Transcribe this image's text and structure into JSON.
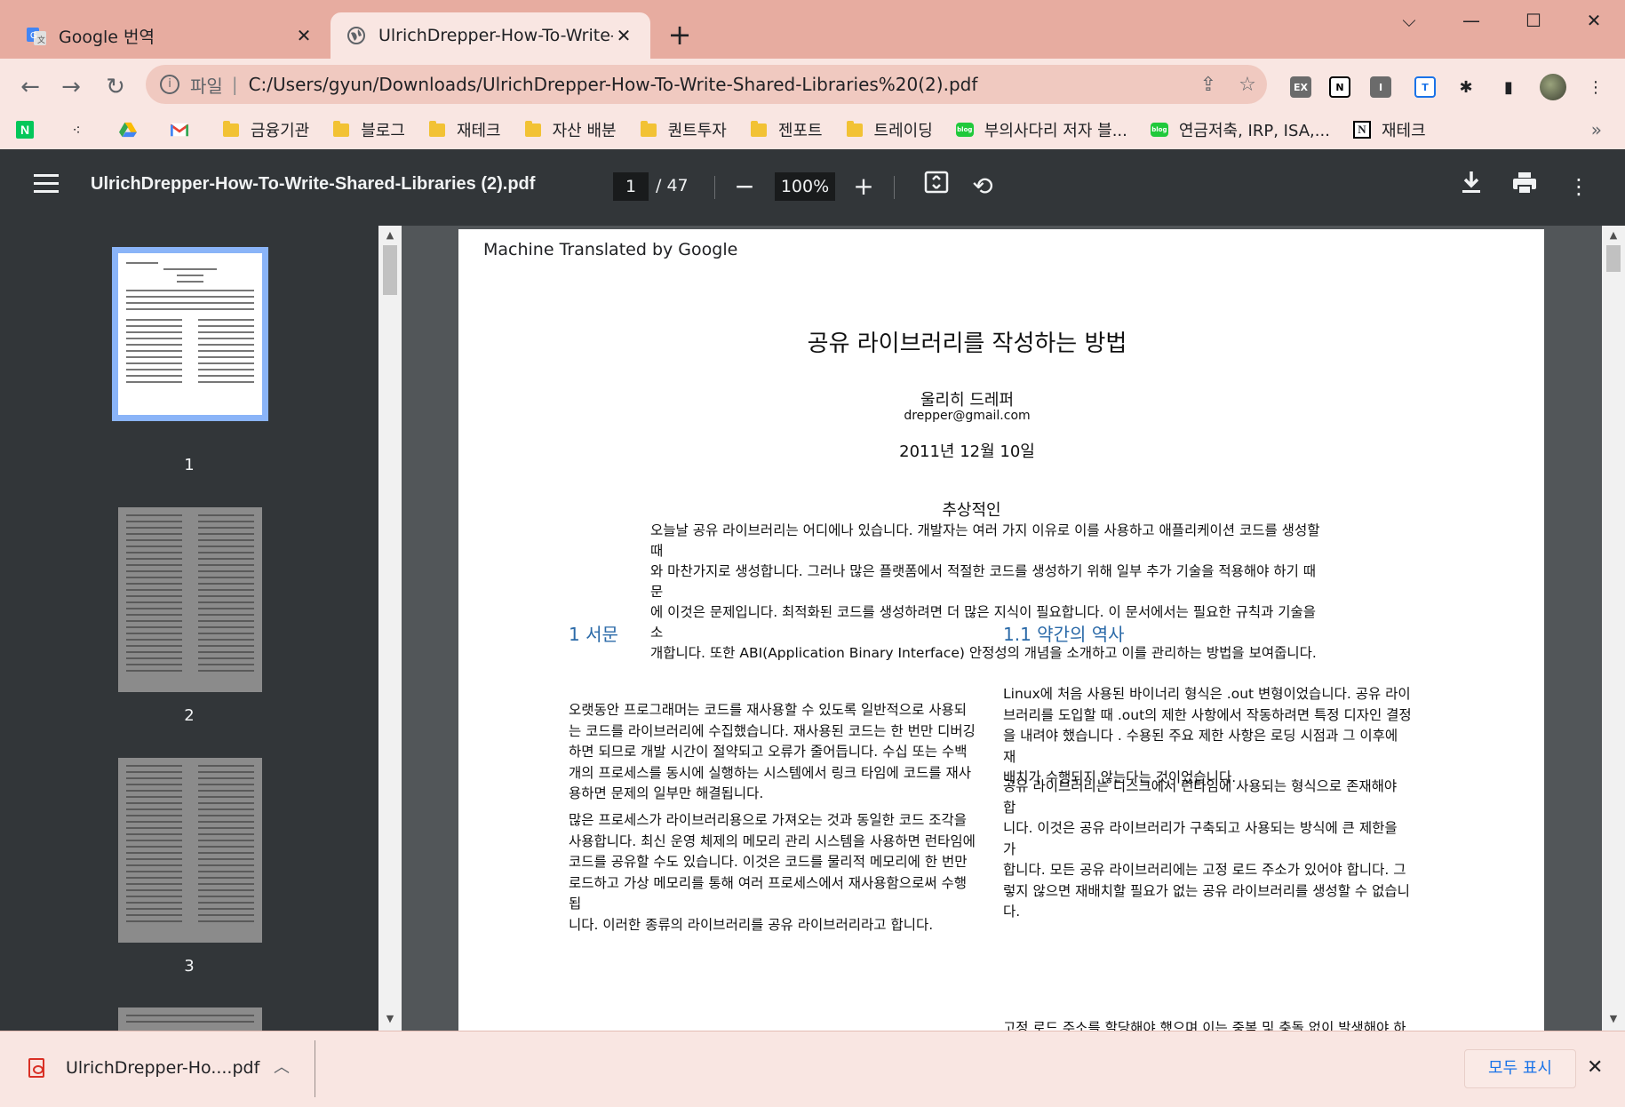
{
  "tabs": [
    {
      "title": "Google 번역",
      "favicon": "google-translate-icon",
      "active": false
    },
    {
      "title": "UlrichDrepper-How-To-Write-Sh",
      "favicon": "globe-icon",
      "active": true
    }
  ],
  "window": {
    "accent": "#e7aca0",
    "toolbar_bg": "#f9e6e2"
  },
  "omnibox": {
    "scheme": "파일",
    "separator": "|",
    "url": "C:/Users/gyun/Downloads/UlrichDrepper-How-To-Write-Shared-Libraries%20(2).pdf"
  },
  "extensions": [
    {
      "name": "ex-extension-icon",
      "label": "EX"
    },
    {
      "name": "notion-extension-icon",
      "label": "N"
    },
    {
      "name": "i-extension-icon",
      "label": "I"
    },
    {
      "name": "translate-extension-icon",
      "label": "T"
    },
    {
      "name": "puzzle-extension-icon",
      "label": "✱"
    },
    {
      "name": "sidepanel-icon",
      "label": "▮"
    },
    {
      "name": "profile-avatar-icon",
      "label": ""
    },
    {
      "name": "chrome-menu-icon",
      "label": "⋮"
    }
  ],
  "bookmarks": [
    {
      "label": "",
      "icon": "naver-icon"
    },
    {
      "label": "",
      "icon": "dots-app-icon"
    },
    {
      "label": "",
      "icon": "google-drive-icon"
    },
    {
      "label": "",
      "icon": "gmail-icon"
    },
    {
      "label": "금융기관",
      "icon": "folder-icon"
    },
    {
      "label": "블로그",
      "icon": "folder-icon"
    },
    {
      "label": "재테크",
      "icon": "folder-icon"
    },
    {
      "label": "자산 배분",
      "icon": "folder-icon"
    },
    {
      "label": "퀀트투자",
      "icon": "folder-icon"
    },
    {
      "label": "젠포트",
      "icon": "folder-icon"
    },
    {
      "label": "트레이딩",
      "icon": "folder-icon"
    },
    {
      "label": "부의사다리 저자 블...",
      "icon": "blog-icon"
    },
    {
      "label": "연금저축, IRP, ISA,...",
      "icon": "blog-icon"
    },
    {
      "label": "재테크",
      "icon": "notion-icon"
    }
  ],
  "bookmarks_more": "»",
  "pdf": {
    "title": "UlrichDrepper-How-To-Write-Shared-Libraries (2).pdf",
    "page_current": "1",
    "page_total": "/ 47",
    "zoom": "100%",
    "thumbnails": [
      "1",
      "2",
      "3"
    ]
  },
  "document": {
    "watermark": "Machine Translated by Google",
    "title": "공유 라이브러리를 작성하는 방법",
    "author": "울리히 드레퍼",
    "email": "drepper@gmail.com",
    "date": "2011년 12월 10일",
    "abstract_title": "추상적인",
    "abstract_lines": [
      "오늘날 공유 라이브러리는 어디에나 있습니다. 개발자는 여러 가지 이유로 이를 사용하고 애플리케이션 코드를 생성할 때",
      "와 마찬가지로 생성합니다. 그러나 많은 플랫폼에서 적절한 코드를 생성하기 위해 일부 추가 기술을 적용해야 하기 때문",
      "에 이것은 문제입니다. 최적화된 코드를 생성하려면 더 많은 지식이 필요합니다. 이 문서에서는 필요한 규칙과 기술을 소",
      "개합니다. 또한 ABI(Application Binary Interface) 안정성의 개념을 소개하고 이를 관리하는 방법을 보여줍니다."
    ],
    "section1_title": "1 서문",
    "section1_p1": [
      "오랫동안 프로그래머는 코드를 재사용할 수 있도록 일반적으로 사용되",
      "는 코드를 라이브러리에 수집했습니다. 재사용된 코드는 한 번만 디버깅",
      "하면 되므로 개발 시간이 절약되고 오류가 줄어듭니다. 수십 또는 수백",
      "개의 프로세스를 동시에 실행하는 시스템에서 링크 타임에 코드를 재사",
      "용하면 문제의 일부만 해결됩니다."
    ],
    "section1_p2": [
      "많은 프로세스가 라이브러리용으로 가져오는 것과 동일한 코드 조각을",
      "사용합니다. 최신 운영 체제의 메모리 관리 시스템을 사용하면 런타임에",
      "코드를 공유할 수도 있습니다. 이것은 코드를 물리적 메모리에 한 번만",
      "로드하고 가상 메모리를 통해 여러 프로세스에서 재사용함으로써 수행됩",
      "니다. 이러한 종류의 라이브러리를 공유 라이브러리라고 합니다."
    ],
    "section2_title": "1.1 약간의 역사",
    "section2_p1": [
      "Linux에 처음 사용된 바이너리 형식은 .out 변형이었습니다. 공유 라이",
      "브러리를 도입할 때 .out의 제한 사항에서 작동하려면 특정 디자인 결정",
      "을 내려야 했습니다 . 수용된 주요 제한 사항은 로딩 시점과 그 이후에 재",
      "배치가 수행되지 않는다는 것이었습니다."
    ],
    "section2_p2": [
      "공유 라이브러리는 디스크에서 런타임에 사용되는 형식으로 존재해야 합",
      "니다. 이것은 공유 라이브러리가 구축되고 사용되는 방식에 큰 제한을 가",
      "합니다. 모든 공유 라이브러리에는 고정 로드 주소가 있어야 합니다. 그",
      "렇지 않으면 재배치할 필요가 없는 공유 라이브러리를 생성할 수 없습니",
      "다."
    ],
    "section2_p3_partial": "고정 로드 주소를 할당해야 했으며 이는 중복 및 충돌 없이 발생해야 하"
  },
  "downloads": {
    "file": "UlrichDrepper-Ho....pdf",
    "show_all": "모두 표시"
  }
}
